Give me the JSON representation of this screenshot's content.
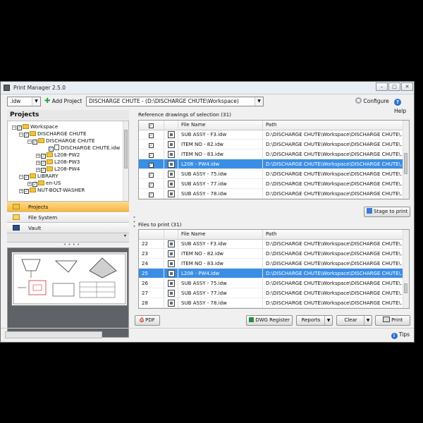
{
  "window": {
    "title": "Print Manager 2.5.0",
    "minimize": "0",
    "maximize": "1",
    "close": "r"
  },
  "toolbar": {
    "filetype": ".idw",
    "add_project": "Add Project",
    "project_path": "DISCHARGE CHUTE  -  (D:\\DISCHARGE CHUTE\\Workspace)",
    "configure": "Configure",
    "help": "Help"
  },
  "projects_panel": {
    "heading": "Projects",
    "tree": [
      {
        "label": "Workspace"
      },
      {
        "label": "DISCHARGE CHUTE"
      },
      {
        "label": "DISCHARGE CHUTE"
      },
      {
        "label": "DISCHARGE CHUTE.idw"
      },
      {
        "label": "L208-PW2"
      },
      {
        "label": "L208-PW3"
      },
      {
        "label": "L208-PW4"
      },
      {
        "label": "LIBRARY"
      },
      {
        "label": "en-US"
      },
      {
        "label": "NUT-BOLT-WASHER"
      }
    ],
    "nav": [
      {
        "label": "Projects",
        "active": true
      },
      {
        "label": "File System",
        "active": false
      },
      {
        "label": "Vault",
        "active": false
      }
    ]
  },
  "reference": {
    "label": "Reference drawings of selection (31)",
    "headers": {
      "filename": "File Name",
      "path": "Path"
    },
    "rows": [
      {
        "name": "SUB ASSY - F3.idw",
        "path": "D:\\DISCHARGE CHUTE\\Workspace\\DISCHARGE CHUTE\\...",
        "selected": false
      },
      {
        "name": "ITEM NO - 82.idw",
        "path": "D:\\DISCHARGE CHUTE\\Workspace\\DISCHARGE CHUTE\\...",
        "selected": false
      },
      {
        "name": "ITEM NO - 83.idw",
        "path": "D:\\DISCHARGE CHUTE\\Workspace\\DISCHARGE CHUTE\\...",
        "selected": false
      },
      {
        "name": "L208 - PW4.idw",
        "path": "D:\\DISCHARGE CHUTE\\Workspace\\DISCHARGE CHUTE\\...",
        "selected": true
      },
      {
        "name": "SUB ASSY - 75.idw",
        "path": "D:\\DISCHARGE CHUTE\\Workspace\\DISCHARGE CHUTE\\...",
        "selected": false
      },
      {
        "name": "SUB ASSY - 77.idw",
        "path": "D:\\DISCHARGE CHUTE\\Workspace\\DISCHARGE CHUTE\\...",
        "selected": false
      },
      {
        "name": "SUB ASSY - 78.idw",
        "path": "D:\\DISCHARGE CHUTE\\Workspace\\DISCHARGE CHUTE\\...",
        "selected": false
      }
    ],
    "stage_button": "Stage to print"
  },
  "files": {
    "label": "Files to print (31)",
    "headers": {
      "filename": "File Name",
      "path": "Path"
    },
    "rows": [
      {
        "num": "22",
        "name": "SUB ASSY - F3.idw",
        "path": "D:\\DISCHARGE CHUTE\\Workspace\\DISCHARGE CHUTE\\...",
        "selected": false
      },
      {
        "num": "23",
        "name": "ITEM NO - 82.idw",
        "path": "D:\\DISCHARGE CHUTE\\Workspace\\DISCHARGE CHUTE\\...",
        "selected": false
      },
      {
        "num": "24",
        "name": "ITEM NO - 83.idw",
        "path": "D:\\DISCHARGE CHUTE\\Workspace\\DISCHARGE CHUTE\\...",
        "selected": false
      },
      {
        "num": "25",
        "name": "L208 - PW4.idw",
        "path": "D:\\DISCHARGE CHUTE\\Workspace\\DISCHARGE CHUTE\\...",
        "selected": true
      },
      {
        "num": "26",
        "name": "SUB ASSY - 75.idw",
        "path": "D:\\DISCHARGE CHUTE\\Workspace\\DISCHARGE CHUTE\\...",
        "selected": false
      },
      {
        "num": "27",
        "name": "SUB ASSY - 77.idw",
        "path": "D:\\DISCHARGE CHUTE\\Workspace\\DISCHARGE CHUTE\\...",
        "selected": false
      },
      {
        "num": "28",
        "name": "SUB ASSY - 78.idw",
        "path": "D:\\DISCHARGE CHUTE\\Workspace\\DISCHARGE CHUTE\\...",
        "selected": false
      }
    ]
  },
  "buttons": {
    "pdf": "PDF",
    "dwg_register": "DWG Register",
    "reports": "Reports",
    "clear": "Clear",
    "print": "Print"
  },
  "status": {
    "tips": "Tips"
  },
  "colors": {
    "selection": "#3a8ee6",
    "active_nav": "#f6b73c"
  }
}
